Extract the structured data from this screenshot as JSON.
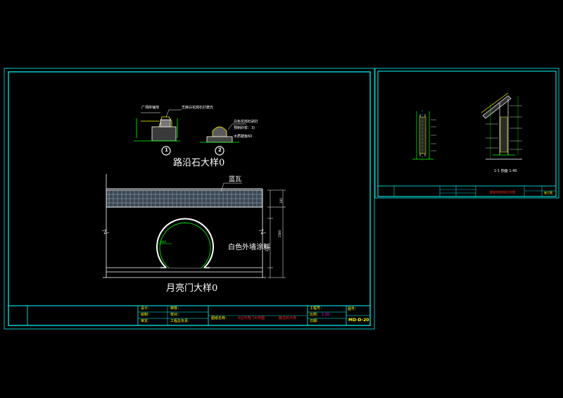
{
  "drawing_main": {
    "detail1_callouts": [
      "广场砖铺地",
      "芝麻白花岗石打磨光"
    ],
    "detail2_callouts": [
      "白色花岗石剁打",
      "预制砂浆：3)",
      "木质踏板60"
    ],
    "detail1_no": "1",
    "detail2_no": "2",
    "curb_title": "路沿石大样0",
    "tile_label": "蓝瓦",
    "wall_label": "白色外墙涂料",
    "radius_label": "R60",
    "moon_gate_title": "月亮门大样0",
    "dims": [
      "100",
      "1500",
      "2000"
    ]
  },
  "title_block": {
    "designer_label": "设计：",
    "checker_label": "审核：",
    "review_label": "审定：",
    "drafter_label": "绘制：",
    "proofer_label": "校对：",
    "manager_label": "工程总负责：",
    "drawing_name_label": "图纸名称：",
    "drawing_name_1": "6边月亮门大样图",
    "drawing_name_2": "路沿石大样",
    "project_no_label": "工程号：",
    "scale_label": "比例：",
    "scale_value": "1:20",
    "date_label": "日期：",
    "sheet_no_label": "图号：",
    "sheet_no_value": "MD-D-20"
  },
  "drawing_side": {
    "section_title": "1-1 剖面  1:40",
    "title_red": "廊架构造剖面大样图",
    "title_block_right": "施工图"
  }
}
